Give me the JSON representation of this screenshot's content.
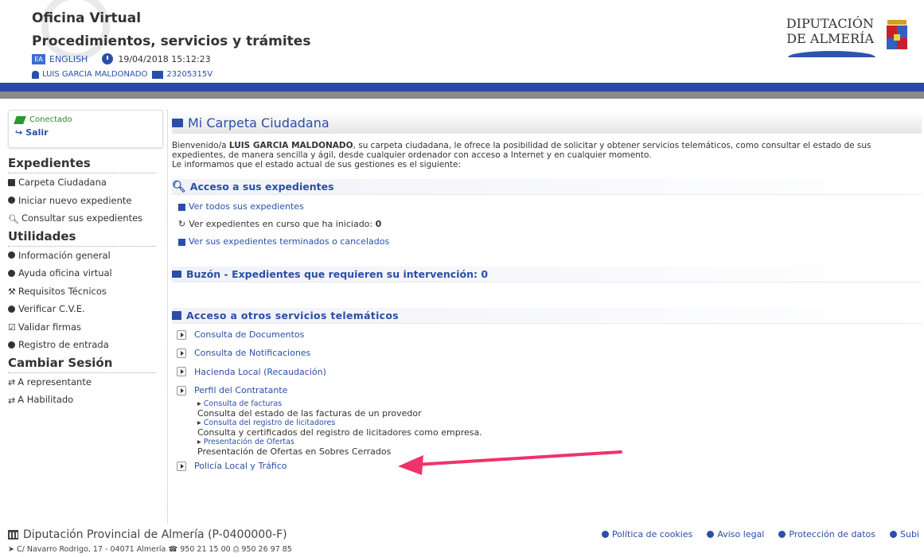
{
  "header": {
    "title": "Oficina Virtual",
    "subtitle": "Procedimientos, servicios y trámites",
    "language": "ENGLISH",
    "datetime": "19/04/2018 15:12:23",
    "user_name": "LUIS GARCIA MALDONADO",
    "user_id": "23205315V",
    "org_line1": "DIPUTACIÓN",
    "org_line2": "DE ALMERÍA",
    "colors": {
      "brand_bar": "#2b48a8",
      "gray_bar": "#8a8a8a",
      "link": "#2a4fa8"
    }
  },
  "sidebar": {
    "status": "Conectado",
    "logout": "Salir",
    "sections": [
      {
        "title": "Expedientes",
        "items": [
          {
            "label": "Carpeta Ciudadana",
            "icon": "folder-icon"
          },
          {
            "label": "Iniciar nuevo expediente",
            "icon": "play-circle-icon"
          },
          {
            "label": "Consultar sus expedientes",
            "icon": "search-icon"
          }
        ]
      },
      {
        "title": "Utilidades",
        "items": [
          {
            "label": "Información general",
            "icon": "info-icon"
          },
          {
            "label": "Ayuda oficina virtual",
            "icon": "help-icon"
          },
          {
            "label": "Requisitos Técnicos",
            "icon": "wrench-icon"
          },
          {
            "label": "Verificar C.V.E.",
            "icon": "check-circle-icon"
          },
          {
            "label": "Validar firmas",
            "icon": "check-square-icon"
          },
          {
            "label": "Registro de entrada",
            "icon": "play-circle-icon"
          }
        ]
      },
      {
        "title": "Cambiar Sesión",
        "items": [
          {
            "label": "A representante",
            "icon": "exchange-icon"
          },
          {
            "label": "A Habilitado",
            "icon": "exchange-icon"
          }
        ]
      }
    ]
  },
  "main": {
    "title": "Mi Carpeta Ciudadana",
    "welcome_prefix": "Bienvenido/a",
    "welcome_name": "LUIS GARCIA MALDONADO",
    "welcome_text": ", su carpeta ciudadana, le ofrece la posibilidad de solicitar y obtener servicios telemáticos, como consultar el estado de sus expedientes, de manera sencilla y ágil, desde cualquier ordenador con acceso a Internet y en cualquier momento.",
    "welcome_text2": "Le informamos que el estado actual de sus gestiones es el siguiente:",
    "acceso": {
      "title": "Acceso a sus expedientes",
      "ver_todos": "Ver todos sus expedientes",
      "en_curso_label": "Ver expedientes en curso que ha iniciado:",
      "en_curso_count": "0",
      "terminados": "Ver sus expedientes terminados o cancelados"
    },
    "buzon": {
      "title": "Buzón - Expedientes que requieren su intervención:",
      "count": "0"
    },
    "otros": {
      "title": "Acceso a otros servicios telemáticos",
      "services": [
        "Consulta de Documentos",
        "Consulta de Notificaciones",
        "Hacienda Local (Recaudación)",
        "Perfil del Contratante"
      ],
      "perfil_sub": [
        {
          "link": "Consulta de facturas",
          "desc": "Consulta del estado de las facturas de un provedor"
        },
        {
          "link": "Consulta del registro de licitadores",
          "desc": "Consulta y certificados del registro de licitadores como empresa."
        },
        {
          "link": "Presentación de Ofertas",
          "desc": "Presentación de Ofertas en Sobres Cerrados"
        }
      ],
      "last_service": "Policía Local y Tráfico"
    }
  },
  "footer": {
    "org": "Diputación Provincial de Almería (P-0400000-F)",
    "address": "C/ Navarro Rodrigo, 17 - 04071 Almería",
    "phone": "950 21 15 00",
    "fax": "950 26 97 85",
    "links": [
      "Política de cookies",
      "Aviso legal",
      "Protección de datos",
      "Subi"
    ]
  },
  "annotation": {
    "arrow_color": "#f0326a"
  }
}
